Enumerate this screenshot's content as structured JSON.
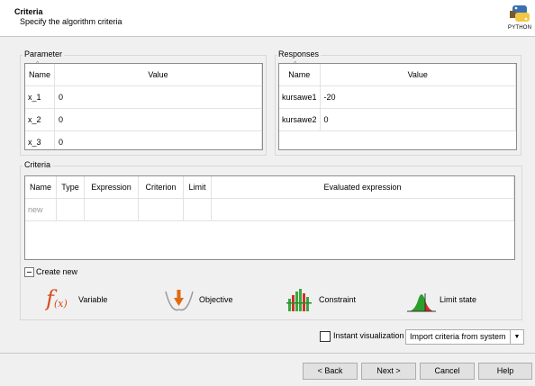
{
  "header": {
    "title": "Criteria",
    "subtitle": "Specify the algorithm criteria",
    "logo_text": "PYTHON"
  },
  "parameter_panel": {
    "label": "Parameter",
    "columns": [
      "Name",
      "Value"
    ],
    "rows": [
      {
        "name": "x_1",
        "value": "0"
      },
      {
        "name": "x_2",
        "value": "0"
      },
      {
        "name": "x_3",
        "value": "0"
      }
    ]
  },
  "responses_panel": {
    "label": "Responses",
    "columns": [
      "Name",
      "Value"
    ],
    "rows": [
      {
        "name": "kursawe1",
        "value": "-20"
      },
      {
        "name": "kursawe2",
        "value": "0"
      }
    ]
  },
  "criteria_panel": {
    "label": "Criteria",
    "columns": [
      "Name",
      "Type",
      "Expression",
      "Criterion",
      "Limit",
      "Evaluated expression"
    ],
    "new_row_placeholder": "new"
  },
  "create_new": {
    "toggle_label": "Create new",
    "items": [
      {
        "label": "Variable",
        "icon": "function-icon"
      },
      {
        "label": "Objective",
        "icon": "objective-icon"
      },
      {
        "label": "Constraint",
        "icon": "constraint-icon"
      },
      {
        "label": "Limit state",
        "icon": "limit-state-icon"
      }
    ]
  },
  "options": {
    "instant_visualization_label": "Instant visualization",
    "instant_visualization_checked": false,
    "import_combo_label": "Import criteria from system"
  },
  "buttons": {
    "back": "< Back",
    "next": "Next >",
    "cancel": "Cancel",
    "help": "Help"
  },
  "colors": {
    "function_red": "#d94a1a",
    "objective_orange": "#e06a10",
    "constraint_green": "#3aa83a",
    "constraint_red": "#d03030",
    "limit_green": "#2aa02a",
    "limit_red": "#d22a2a"
  }
}
